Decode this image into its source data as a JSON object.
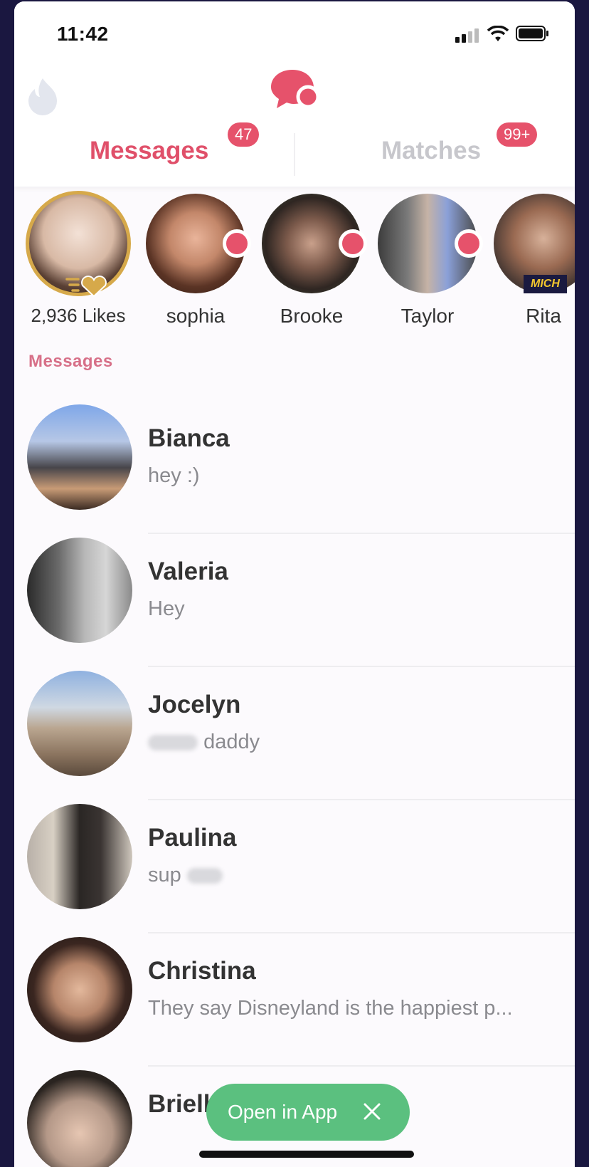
{
  "status_bar": {
    "time": "11:42"
  },
  "header": {
    "tabs": [
      {
        "label": "Messages",
        "badge": "47",
        "active": true
      },
      {
        "label": "Matches",
        "badge": "99+",
        "active": false
      }
    ]
  },
  "matches": {
    "likes_label": "2,936 Likes",
    "items": [
      {
        "name": "sophia",
        "new": true
      },
      {
        "name": "Brooke",
        "new": true
      },
      {
        "name": "Taylor",
        "new": true
      },
      {
        "name": "Rita",
        "new": false
      }
    ],
    "overlay_text": "MICH"
  },
  "messages_section": {
    "label": "Messages",
    "conversations": [
      {
        "name": "Bianca",
        "preview": "hey :)"
      },
      {
        "name": "Valeria",
        "preview": "Hey"
      },
      {
        "name": "Jocelyn",
        "preview": "daddy"
      },
      {
        "name": "Paulina",
        "preview": "sup"
      },
      {
        "name": "Christina",
        "preview": "They say Disneyland is the happiest p..."
      },
      {
        "name": "Brielle",
        "preview": ""
      }
    ]
  },
  "banner": {
    "open_in_app": "Open in App"
  },
  "colors": {
    "brand": "#e6526b",
    "cta": "#5bc07f",
    "gold": "#d6a94a"
  }
}
